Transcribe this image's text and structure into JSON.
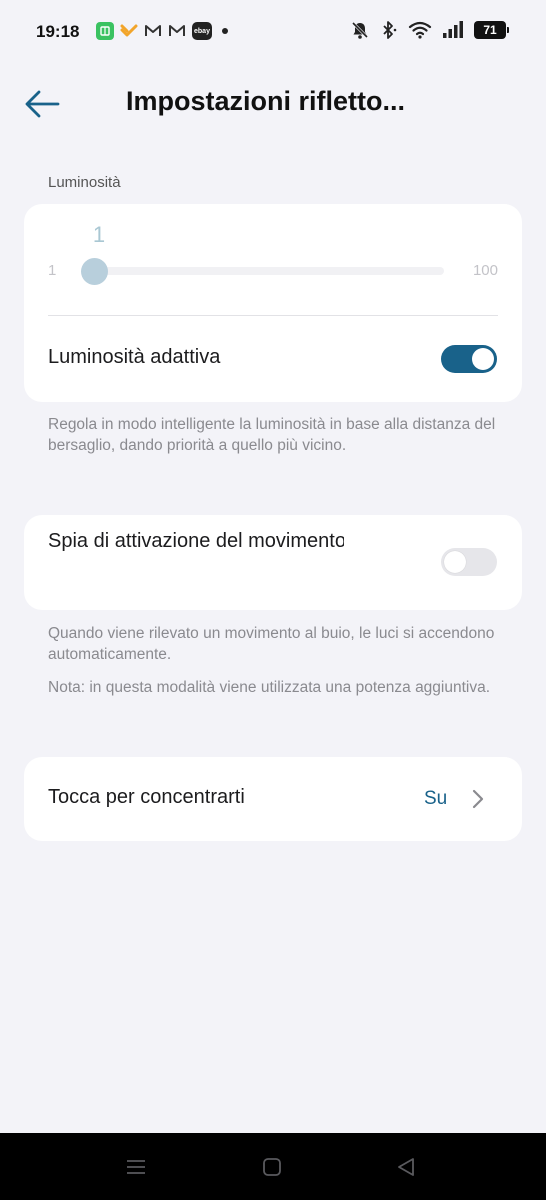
{
  "status_bar": {
    "time": "19:18",
    "battery": "71",
    "notification_icons": [
      "green-app-icon",
      "orange-app-icon",
      "gmail-icon",
      "gmail-icon",
      "ebay-icon",
      "dot-icon"
    ],
    "ebay_label": "ebay",
    "system_icons": [
      "bell-off-icon",
      "bluetooth-icon",
      "wifi-icon",
      "signal-icon",
      "battery-icon"
    ]
  },
  "header": {
    "title": "Impostazioni rifletto..."
  },
  "brightness": {
    "section_label": "Luminosità",
    "value": "1",
    "min_label": "1",
    "max_label": "100",
    "level": 1,
    "adaptive_label": "Luminosità adattiva",
    "adaptive_enabled": true,
    "adaptive_description": "Regola in modo intelligente la luminosità in base alla distanza del bersaglio, dando priorità a quello più vicino."
  },
  "motion": {
    "label": "Spia di attivazione del movimento",
    "enabled": false,
    "description": "Quando viene rilevato un movimento al buio, le luci si accendono automaticamente.",
    "note": "Nota: in questa modalità viene utilizzata una potenza aggiuntiva."
  },
  "focus": {
    "label": "Tocca per concentrarti",
    "value": "Su"
  },
  "colors": {
    "accent": "#19628a",
    "background": "#f3f3f8",
    "card": "#ffffff",
    "slider_thumb": "#b8cfdc"
  }
}
